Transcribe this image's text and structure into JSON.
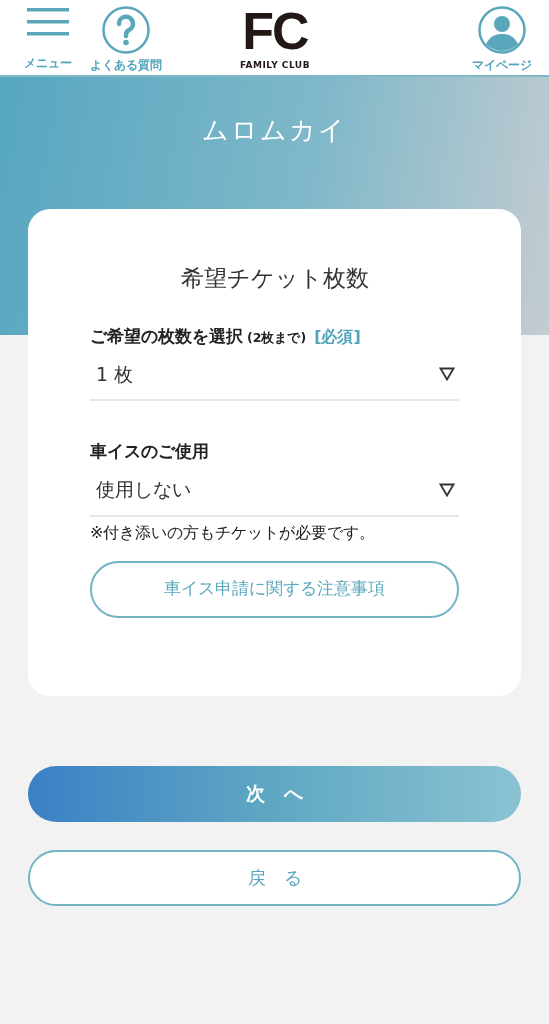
{
  "header": {
    "menu_label": "メニュー",
    "faq_label": "よくある質問",
    "logo": {
      "mark": "FC",
      "name": "FAMILY CLUB"
    },
    "mypage_label": "マイページ"
  },
  "page_title": "ムロムカイ",
  "card": {
    "title": "希望チケット枚数",
    "fields": [
      {
        "label": "ご希望の枚数を選択",
        "hint": "(2枚まで)",
        "required_tag": "[必須]",
        "value": "1 枚"
      },
      {
        "label": "車イスのご使用",
        "value": "使用しない",
        "note": "※付き添いの方もチケットが必要です。"
      }
    ],
    "link_button": "車イス申請に関する注意事項"
  },
  "buttons": [
    {
      "label": "次　へ",
      "kind": "primary"
    },
    {
      "label": "戻　る",
      "kind": "outline"
    }
  ]
}
